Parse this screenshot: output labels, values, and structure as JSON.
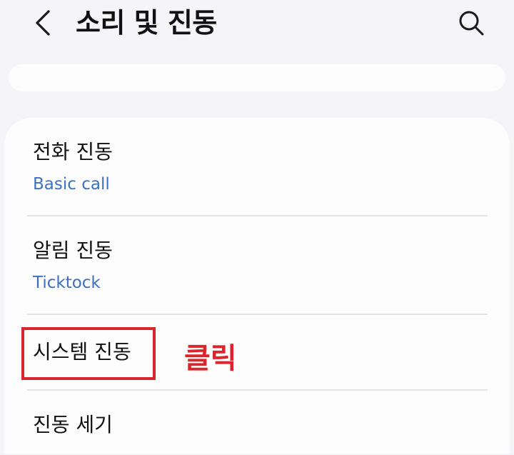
{
  "header": {
    "title": "소리 및 진동",
    "back_icon": "chevron-left-icon",
    "search_icon": "search-icon"
  },
  "items": [
    {
      "title": "전화 진동",
      "subtitle": "Basic call"
    },
    {
      "title": "알림 진동",
      "subtitle": "Ticktock"
    },
    {
      "title": "시스템 진동"
    },
    {
      "title": "진동 세기"
    }
  ],
  "annotation": {
    "label": "클릭",
    "color": "#d9252b"
  },
  "colors": {
    "background": "#f5f5f7",
    "card": "#fdfdfe",
    "subtitle": "#3e6fc2",
    "highlight": "#d9252b"
  }
}
